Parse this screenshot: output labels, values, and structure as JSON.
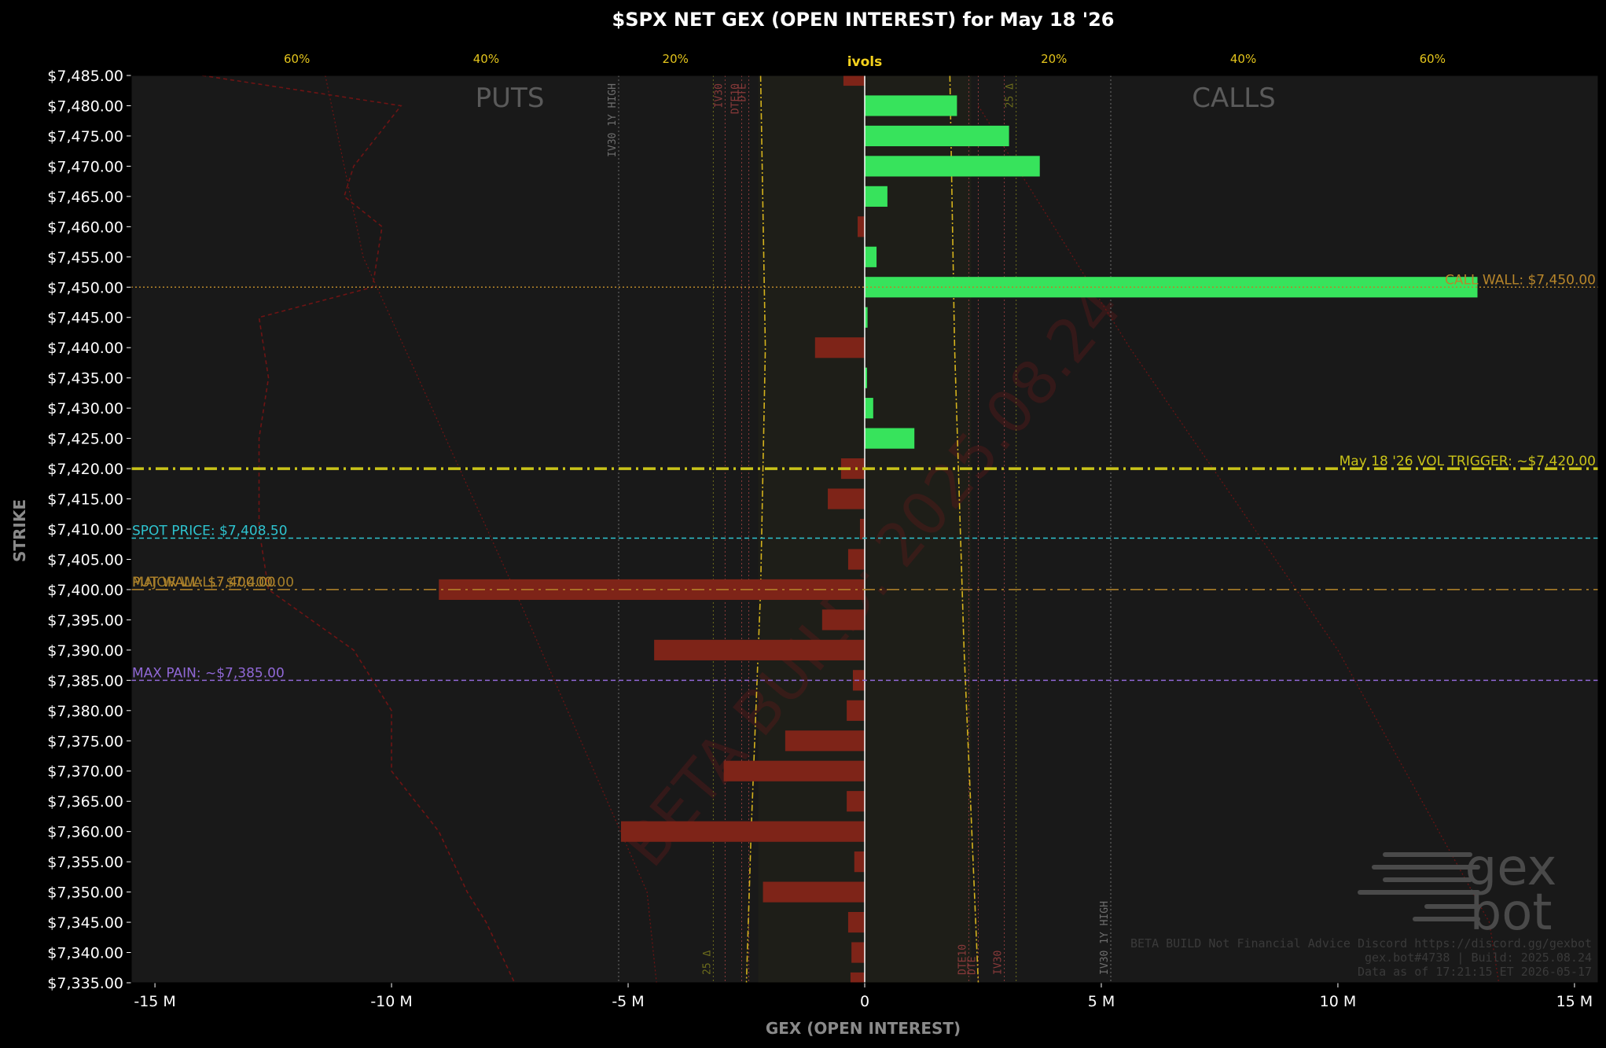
{
  "chart_data": {
    "type": "bar",
    "orientation": "horizontal",
    "title": "$SPX NET GEX (OPEN INTEREST) for May 18 '26",
    "xlabel": "GEX (OPEN INTEREST)",
    "ylabel": "STRIKE",
    "xlim": [
      -15.5,
      15.5
    ],
    "ylim": [
      7335,
      7485
    ],
    "x_ticks": [
      {
        "v": -15,
        "label": "-15 M"
      },
      {
        "v": -10,
        "label": "-10 M"
      },
      {
        "v": -5,
        "label": "-5 M"
      },
      {
        "v": 0,
        "label": "0"
      },
      {
        "v": 5,
        "label": "5 M"
      },
      {
        "v": 10,
        "label": "10 M"
      },
      {
        "v": 15,
        "label": "15 M"
      }
    ],
    "y_ticks": [
      "$7,485.00",
      "$7,480.00",
      "$7,475.00",
      "$7,470.00",
      "$7,465.00",
      "$7,460.00",
      "$7,455.00",
      "$7,450.00",
      "$7,445.00",
      "$7,440.00",
      "$7,435.00",
      "$7,430.00",
      "$7,425.00",
      "$7,420.00",
      "$7,415.00",
      "$7,410.00",
      "$7,405.00",
      "$7,400.00",
      "$7,395.00",
      "$7,390.00",
      "$7,385.00",
      "$7,380.00",
      "$7,375.00",
      "$7,370.00",
      "$7,365.00",
      "$7,360.00",
      "$7,355.00",
      "$7,350.00",
      "$7,345.00",
      "$7,340.00",
      "$7,335.00"
    ],
    "bars": [
      {
        "strike": 7485,
        "value": -0.45
      },
      {
        "strike": 7480,
        "value": 1.95
      },
      {
        "strike": 7475,
        "value": 3.05
      },
      {
        "strike": 7470,
        "value": 3.7
      },
      {
        "strike": 7465,
        "value": 0.48
      },
      {
        "strike": 7460,
        "value": -0.15
      },
      {
        "strike": 7455,
        "value": 0.25
      },
      {
        "strike": 7450,
        "value": 12.95
      },
      {
        "strike": 7445,
        "value": 0.06
      },
      {
        "strike": 7440,
        "value": -1.05
      },
      {
        "strike": 7435,
        "value": 0.05
      },
      {
        "strike": 7430,
        "value": 0.18
      },
      {
        "strike": 7425,
        "value": 1.05
      },
      {
        "strike": 7420,
        "value": -0.5
      },
      {
        "strike": 7415,
        "value": -0.78
      },
      {
        "strike": 7410,
        "value": -0.1
      },
      {
        "strike": 7405,
        "value": -0.35
      },
      {
        "strike": 7400,
        "value": -9.0
      },
      {
        "strike": 7395,
        "value": -0.9
      },
      {
        "strike": 7390,
        "value": -4.45
      },
      {
        "strike": 7385,
        "value": -0.25
      },
      {
        "strike": 7380,
        "value": -0.38
      },
      {
        "strike": 7375,
        "value": -1.68
      },
      {
        "strike": 7370,
        "value": -2.98
      },
      {
        "strike": 7365,
        "value": -0.38
      },
      {
        "strike": 7360,
        "value": -5.15
      },
      {
        "strike": 7355,
        "value": -0.22
      },
      {
        "strike": 7350,
        "value": -2.15
      },
      {
        "strike": 7345,
        "value": -0.35
      },
      {
        "strike": 7340,
        "value": -0.28
      },
      {
        "strike": 7335,
        "value": -0.3
      }
    ],
    "ivols_axis": {
      "label": "ivols",
      "ticks": [
        {
          "v": -60,
          "label": "60%"
        },
        {
          "v": -40,
          "label": "40%"
        },
        {
          "v": -20,
          "label": "20%"
        },
        {
          "v": 20,
          "label": "20%"
        },
        {
          "v": 40,
          "label": "40%"
        },
        {
          "v": 60,
          "label": "60%"
        }
      ]
    },
    "levels": [
      {
        "name": "call-wall",
        "strike": 7450,
        "label": "CALL WALL: $7,450.00",
        "color": "#b8862a",
        "style": "dotted",
        "align": "right"
      },
      {
        "name": "vol-trigger",
        "strike": 7420,
        "label": "May 18 '26 VOL TRIGGER: ~$7,420.00",
        "color": "#c9c319",
        "style": "dashdot",
        "align": "right"
      },
      {
        "name": "spot-price",
        "strike": 7408.5,
        "label": "SPOT PRICE: $7,408.50",
        "color": "#2ec4d0",
        "style": "dashed",
        "align": "left"
      },
      {
        "name": "put-wall",
        "strike": 7400,
        "label": "PUT WALL: $7,400.00",
        "color": "#b8862a",
        "style": "dashdot",
        "align": "left"
      },
      {
        "name": "major-wall",
        "strike": 7400,
        "label": "MAJOR WALL: $7,400.00",
        "color": "#a57f2a",
        "style": "none",
        "align": "left"
      },
      {
        "name": "max-pain",
        "strike": 7385,
        "label": "MAX PAIN: ~$7,385.00",
        "color": "#9068d6",
        "style": "dashed",
        "align": "left"
      }
    ],
    "vertical_guides": [
      {
        "name": "iv30-1y-high-put",
        "x": -5.2,
        "label": "IV30 1Y HIGH",
        "label_pos": "top",
        "color": "#6e6e6e"
      },
      {
        "name": "iv30-put",
        "x": -2.95,
        "label": "IV30",
        "label_pos": "top",
        "color": "#8a3a3a"
      },
      {
        "name": "dte-put-a",
        "x": -2.6,
        "label": "DTE10",
        "label_pos": "top",
        "color": "#8a3a3a"
      },
      {
        "name": "dte-put-b",
        "x": -2.45,
        "label": "DTE",
        "label_pos": "top",
        "color": "#8a3a3a"
      },
      {
        "name": "delta25-put",
        "x": -3.2,
        "label": "25 Δ",
        "label_pos": "bottom",
        "color": "#6d6d1c"
      },
      {
        "name": "dte-call-a",
        "x": 2.2,
        "label": "DTE10",
        "label_pos": "bottom",
        "color": "#8a3a3a"
      },
      {
        "name": "dte-call-b",
        "x": 2.4,
        "label": "DTE",
        "label_pos": "bottom",
        "color": "#8a3a3a"
      },
      {
        "name": "iv30-call",
        "x": 2.95,
        "label": "IV30",
        "label_pos": "bottom",
        "color": "#8a3a3a"
      },
      {
        "name": "delta25-call",
        "x": 3.2,
        "label": "25 Δ",
        "label_pos": "top",
        "color": "#6d6d1c"
      },
      {
        "name": "iv30-1y-high-call",
        "x": 5.2,
        "label": "IV30 1Y HIGH",
        "label_pos": "bottom",
        "color": "#6e6e6e"
      }
    ],
    "side_labels": {
      "puts": "PUTS",
      "calls": "CALLS"
    },
    "colors": {
      "positive": "#37e35c",
      "negative": "#7e2418",
      "background": "#191919",
      "figure": "#000000"
    }
  },
  "watermark": "BETA BUILD: 2025.08.24",
  "logo": {
    "line1": "gex",
    "line2": "bot"
  },
  "footer": [
    "BETA BUILD Not Financial Advice Discord https://discord.gg/gexbot",
    "gex.bot#4738 | Build: 2025.08.24",
    "Data as of 17:21:15 ET 2026-05-17"
  ]
}
